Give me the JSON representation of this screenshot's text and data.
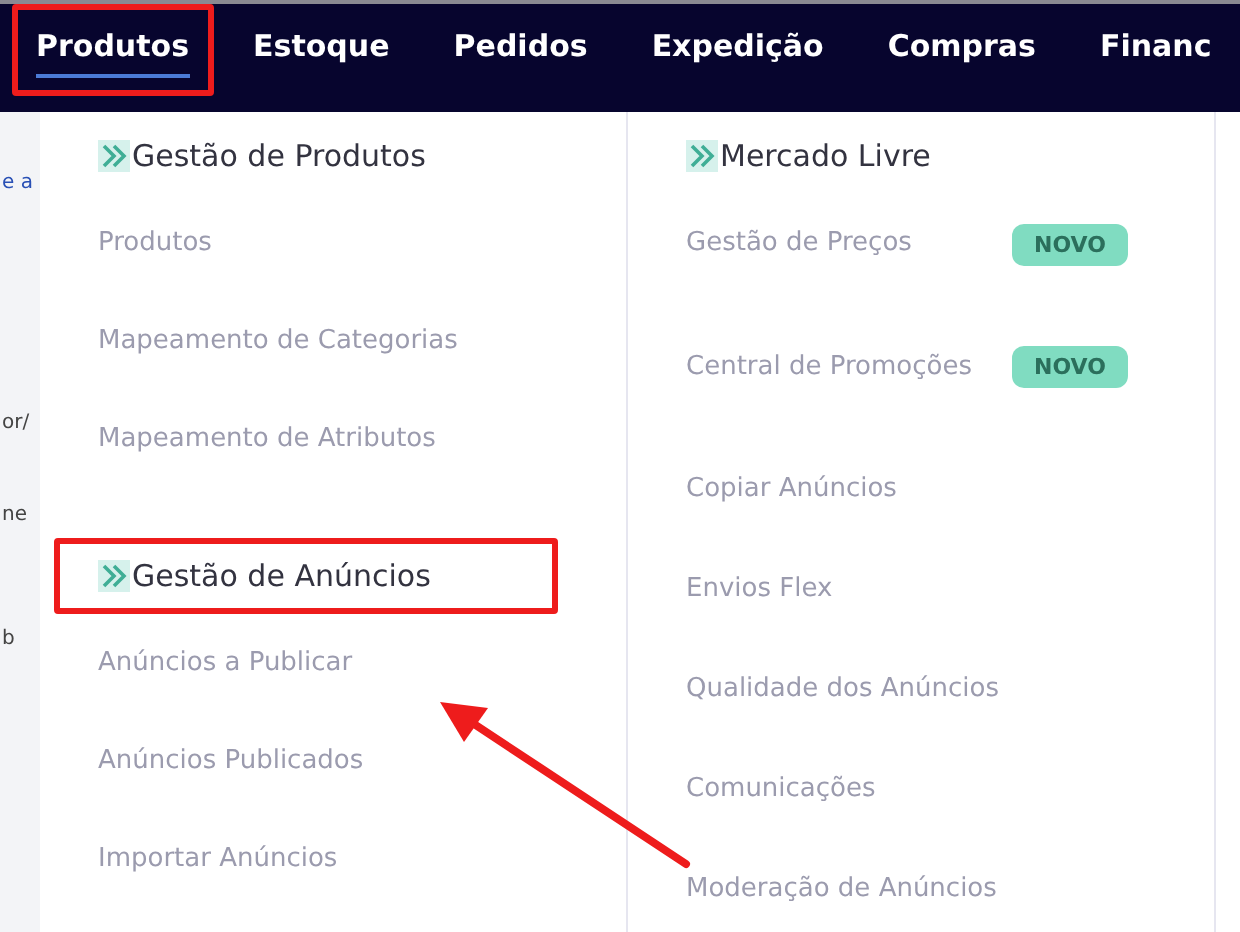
{
  "nav": {
    "tabs": [
      {
        "label": "Produtos",
        "selected": true,
        "highlighted": true
      },
      {
        "label": "Estoque",
        "selected": false,
        "highlighted": false
      },
      {
        "label": "Pedidos",
        "selected": false,
        "highlighted": false
      },
      {
        "label": "Expedição",
        "selected": false,
        "highlighted": false
      },
      {
        "label": "Compras",
        "selected": false,
        "highlighted": false
      },
      {
        "label": "Financ",
        "selected": false,
        "highlighted": false
      }
    ]
  },
  "annotation_arrow": true,
  "background_fragments": [
    "e a",
    "or/",
    "ne",
    "b"
  ],
  "menu": {
    "columns": [
      {
        "sections": [
          {
            "title": "Gestão de Produtos",
            "highlighted": false,
            "items": [
              {
                "label": "Produtos"
              },
              {
                "label": "Mapeamento de Categorias"
              },
              {
                "label": "Mapeamento de Atributos"
              }
            ]
          },
          {
            "title": "Gestão de Anúncios",
            "highlighted": true,
            "items": [
              {
                "label": "Anúncios a Publicar"
              },
              {
                "label": "Anúncios Publicados"
              },
              {
                "label": "Importar Anúncios"
              }
            ]
          }
        ]
      },
      {
        "sections": [
          {
            "title": "Mercado Livre",
            "highlighted": false,
            "items": [
              {
                "label": "Gestão de Preços",
                "badge": "NOVO"
              },
              {
                "label": "Central de Promoções",
                "badge": "NOVO"
              },
              {
                "label": "Copiar Anúncios"
              },
              {
                "label": "Envios Flex"
              },
              {
                "label": "Qualidade dos Anúncios"
              },
              {
                "label": "Comunicações"
              },
              {
                "label": "Moderação de Anúncios"
              }
            ]
          }
        ]
      }
    ]
  }
}
